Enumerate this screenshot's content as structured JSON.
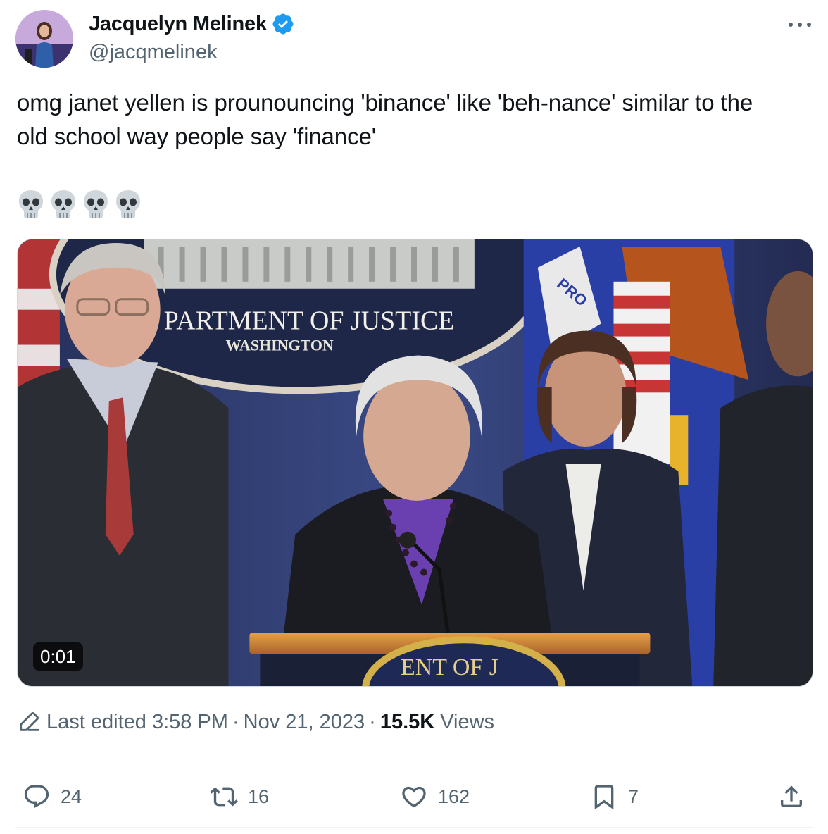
{
  "author": {
    "display_name": "Jacquelyn Melinek",
    "handle": "@jacqmelinek",
    "verified": true,
    "verified_color": "#1d9bf0"
  },
  "tweet": {
    "text": "omg janet yellen is prounouncing 'binance' like 'beh-nance' similar to the\nold school way people say 'finance'",
    "emoji": [
      "skull-icon",
      "skull-icon",
      "skull-icon",
      "skull-icon"
    ]
  },
  "media": {
    "video_timestamp": "0:01",
    "background_sign_line1": "PARTMENT OF JUSTICE",
    "background_sign_line2": "WASHINGTON",
    "flag_text": "PRO",
    "podium_seal_text": "ENT OF J"
  },
  "meta": {
    "edited_label": "Last edited 3:58 PM",
    "separator": "·",
    "date": "Nov 21, 2023",
    "views_count": "15.5K",
    "views_label": "Views"
  },
  "actions": {
    "replies": "24",
    "reposts": "16",
    "likes": "162",
    "bookmarks": "7"
  },
  "colors": {
    "text_primary": "#0f1419",
    "text_secondary": "#536471",
    "divider": "#eff3f4"
  }
}
